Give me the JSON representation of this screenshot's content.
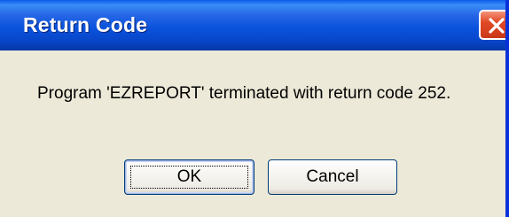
{
  "dialog": {
    "title": "Return Code",
    "message": "Program 'EZREPORT' terminated with return code 252.",
    "close_icon": "close-icon",
    "buttons": {
      "ok_label": "OK",
      "cancel_label": "Cancel"
    }
  },
  "colors": {
    "titlebar": "#0a53dd",
    "close_button": "#e24a26",
    "dialog_background": "#ece9d8",
    "title_text": "#ffffff"
  }
}
